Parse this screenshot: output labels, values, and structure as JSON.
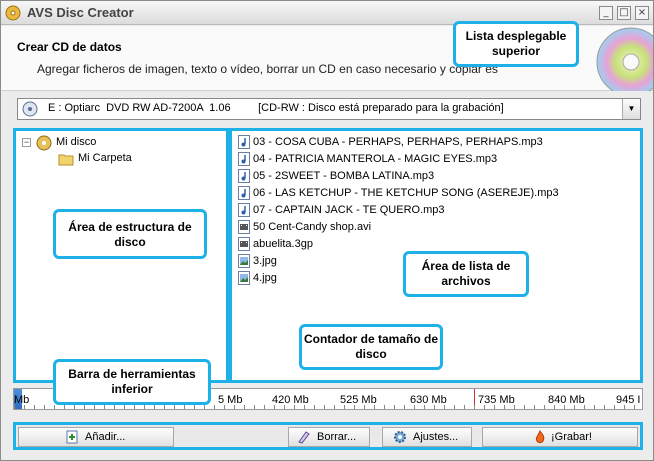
{
  "window": {
    "title": "AVS Disc Creator",
    "minimize_glyph": "_",
    "maximize_glyph": "□",
    "close_glyph": "×"
  },
  "header": {
    "title": "Crear CD de datos",
    "subtitle": "Agregar ficheros de imagen, texto o vídeo, borrar un CD en caso necesario y copiar es"
  },
  "drive": {
    "selected": "E : Optiarc  DVD RW AD-7200A  1.06         [CD-RW : Disco está preparado para la grabación]",
    "dropdown_glyph": "▼"
  },
  "tree": {
    "root_label": "Mi disco",
    "root_expander": "−",
    "child_label": "Mi Carpeta"
  },
  "files": [
    {
      "name": "03 - COSA CUBA - PERHAPS, PERHAPS, PERHAPS.mp3",
      "icon": "audio-file-icon"
    },
    {
      "name": "04 - PATRICIA MANTEROLA - MAGIC EYES.mp3",
      "icon": "audio-file-icon"
    },
    {
      "name": "05 - 2SWEET - BOMBA LATINA.mp3",
      "icon": "audio-file-icon"
    },
    {
      "name": "06 - LAS KETCHUP - THE KETCHUP SONG (ASEREJE).mp3",
      "icon": "audio-file-icon"
    },
    {
      "name": "07 - CAPTAIN JACK - TE QUERO.mp3",
      "icon": "audio-file-icon"
    },
    {
      "name": "50 Cent-Candy shop.avi",
      "icon": "video-file-icon"
    },
    {
      "name": "abuelita.3gp",
      "icon": "video-file-icon"
    },
    {
      "name": "3.jpg",
      "icon": "image-file-icon"
    },
    {
      "name": "4.jpg",
      "icon": "image-file-icon"
    }
  ],
  "size_counter": {
    "ticks": [
      "Mb",
      "5 Mb",
      "420 Mb",
      "525 Mb",
      "630 Mb",
      "735 Mb",
      "840 Mb",
      "945 I"
    ]
  },
  "toolbar": {
    "add_label": "Añadir...",
    "erase_label": "Borrar...",
    "settings_label": "Ajustes...",
    "burn_label": "¡Grabar!"
  },
  "callouts": {
    "top_dropdown": "Lista desplegable superior",
    "tree_area": "Área de estructura de disco",
    "file_list_area": "Área de lista de archivos",
    "size_counter": "Contador de tamaño de disco",
    "bottom_toolbar": "Barra de herramientas inferior"
  },
  "colors": {
    "highlight": "#1eb1e8",
    "progress": "#2d6cc0"
  }
}
